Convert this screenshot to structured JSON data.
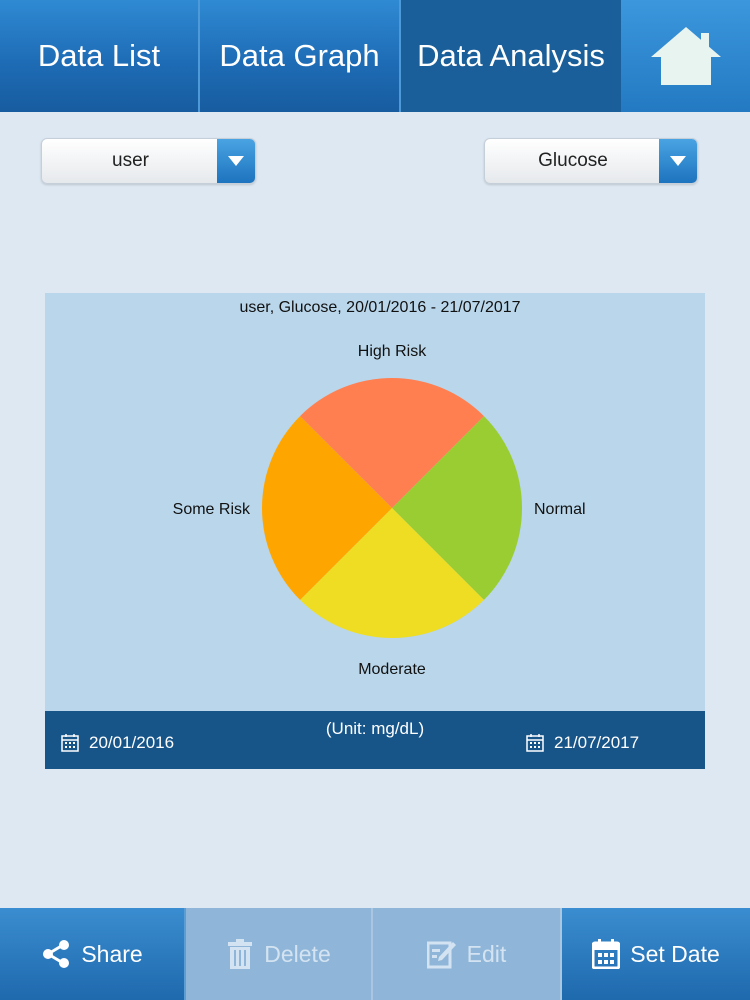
{
  "nav": {
    "tabs": [
      "Data List",
      "Data Graph",
      "Data Analysis"
    ],
    "active_tab": "Data Analysis",
    "home_icon": "home-icon"
  },
  "selectors": {
    "user": "user",
    "measure": "Glucose"
  },
  "chart_data": {
    "type": "pie",
    "title": "user, Glucose, 20/01/2016 - 21/07/2017",
    "slices": [
      {
        "label": "Normal",
        "value": 25,
        "color": "#9acd32"
      },
      {
        "label": "Moderate",
        "value": 25,
        "color": "#eedd22"
      },
      {
        "label": "Some Risk",
        "value": 25,
        "color": "#ffa500"
      },
      {
        "label": "High Risk",
        "value": 25,
        "color": "#ff7f50"
      }
    ]
  },
  "footer": {
    "unit": "(Unit: mg/dL)",
    "start_date": "20/01/2016",
    "end_date": "21/07/2017"
  },
  "toolbar": {
    "share": "Share",
    "delete": "Delete",
    "edit": "Edit",
    "set_date": "Set Date"
  }
}
